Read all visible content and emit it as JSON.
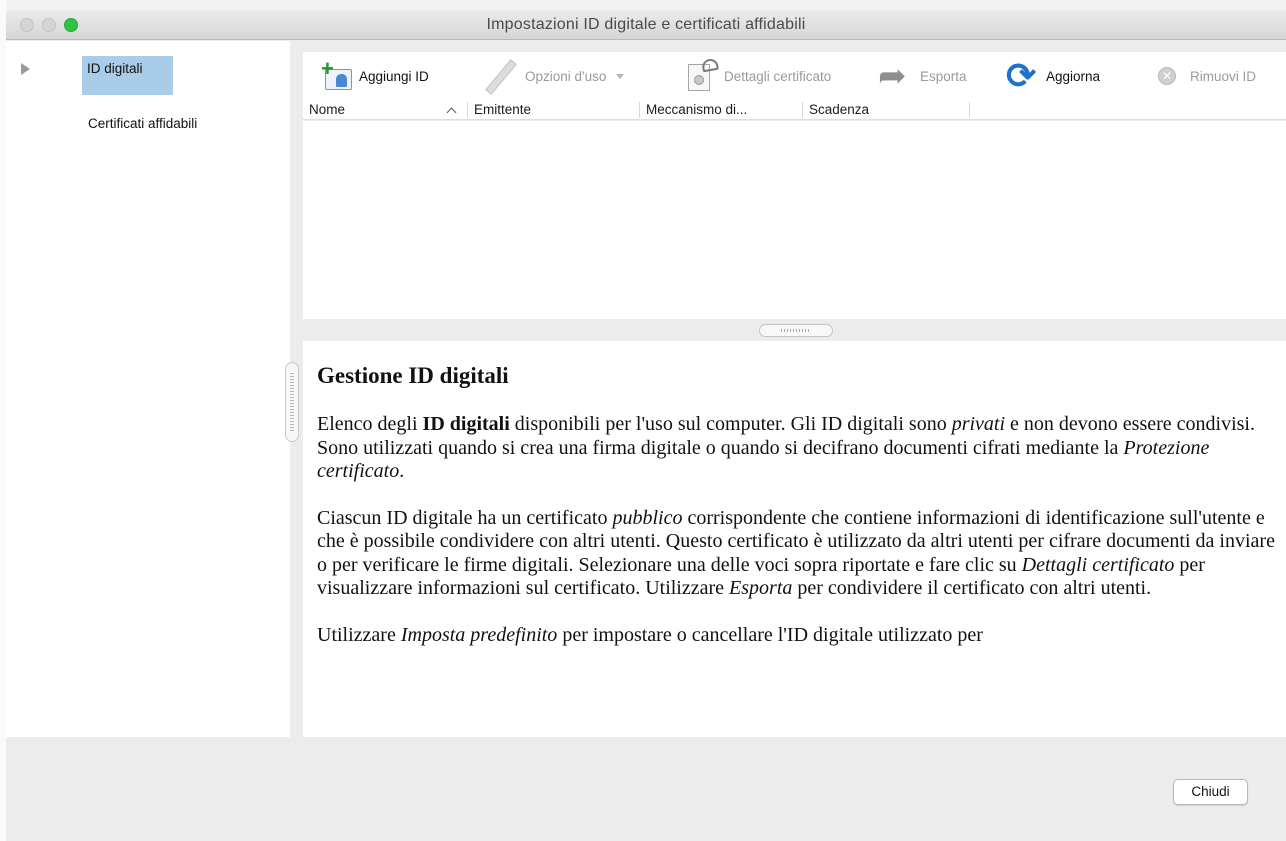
{
  "window": {
    "title": "Impostazioni ID digitale e certificati affidabili"
  },
  "sidebar": {
    "items": [
      {
        "label": "ID digitali",
        "selected": true
      },
      {
        "label": "Certificati affidabili",
        "selected": false
      }
    ]
  },
  "toolbar": {
    "add_id": "Aggiungi ID",
    "usage_options": "Opzioni d'uso",
    "cert_details": "Dettagli certificato",
    "export": "Esporta",
    "refresh": "Aggiorna",
    "remove_id": "Rimuovi ID"
  },
  "table": {
    "columns": [
      "Nome",
      "Emittente",
      "Meccanismo di...",
      "Scadenza"
    ],
    "sort_column": "Nome",
    "rows": []
  },
  "description": {
    "heading": "Gestione ID digitali",
    "p1_a": "Elenco degli ",
    "p1_b": "ID digitali",
    "p1_c": " disponibili per l'uso sul computer. Gli ID digitali sono ",
    "p1_d": "privati",
    "p1_e": " e non devono essere condivisi. Sono utilizzati quando si crea una firma digitale o quando si decifrano documenti cifrati mediante la ",
    "p1_f": "Protezione certificato",
    "p1_g": ".",
    "p2_a": "Ciascun ID digitale ha un certificato ",
    "p2_b": "pubblico",
    "p2_c": " corrispondente che contiene informazioni di identificazione sull'utente e che è possibile condividere con altri utenti. Questo certificato è utilizzato da altri utenti per cifrare documenti da inviare o per verificare le firme digitali. Selezionare una delle voci sopra riportate e fare clic su ",
    "p2_d": "Dettagli certificato",
    "p2_e": " per visualizzare informazioni sul certificato. Utilizzare ",
    "p2_f": "Esporta",
    "p2_g": " per condividere il certificato con altri utenti.",
    "p3_a": "Utilizzare ",
    "p3_b": "Imposta predefinito",
    "p3_c": " per impostare o cancellare l'ID digitale utilizzato per"
  },
  "footer": {
    "close": "Chiudi"
  },
  "colors": {
    "selection": "#a9cce9",
    "refresh_icon": "#1e72c9",
    "zoom_button": "#2dc443"
  }
}
